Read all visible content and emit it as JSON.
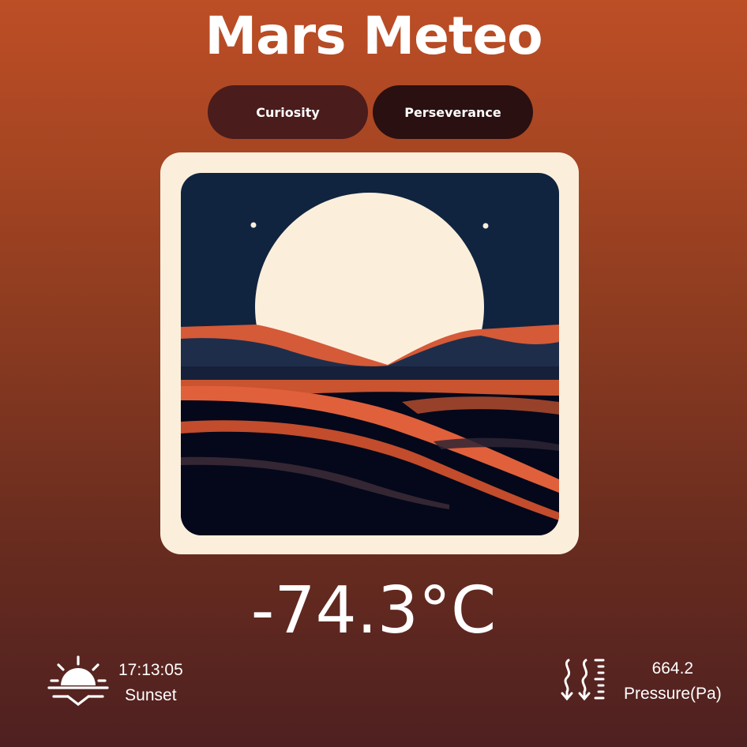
{
  "app": {
    "title": "Mars Meteo"
  },
  "rovers": {
    "tabs": [
      {
        "label": "Curiosity"
      },
      {
        "label": "Perseverance"
      }
    ]
  },
  "weather": {
    "temperature": "-74.3°C",
    "sunset": {
      "value": "17:13:05",
      "label": "Sunset",
      "icon": "sunset-icon"
    },
    "pressure": {
      "value": "664.2",
      "label": "Pressure(Pa)",
      "icon": "pressure-icon"
    }
  },
  "colors": {
    "background_top": "#bd4e26",
    "background_bottom": "#4e2020",
    "tab_curiosity": "#4a1c1c",
    "tab_perseverance": "#2a1010",
    "frame": "#fbefdc",
    "sky": "#102440",
    "dune_orange": "#d55a38"
  }
}
